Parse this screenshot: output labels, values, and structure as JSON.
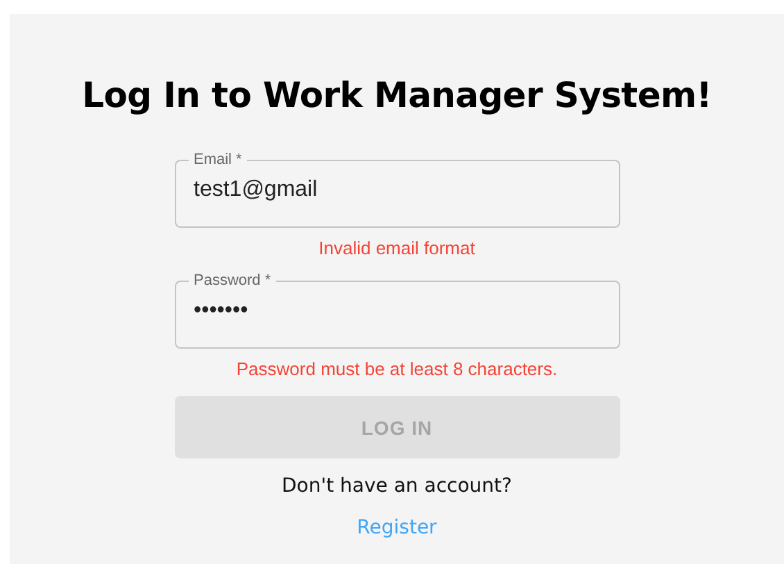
{
  "title": "Log In to Work Manager System!",
  "fields": [
    {
      "label": "Email *",
      "value": "test1@gmail",
      "error": "Invalid email format"
    },
    {
      "label": "Password *",
      "value": "•••••••",
      "error": "Password must be at least 8 characters."
    }
  ],
  "button": {
    "label": "LOG IN",
    "disabled": true
  },
  "prompt": "Don't have an account?",
  "link": "Register"
}
